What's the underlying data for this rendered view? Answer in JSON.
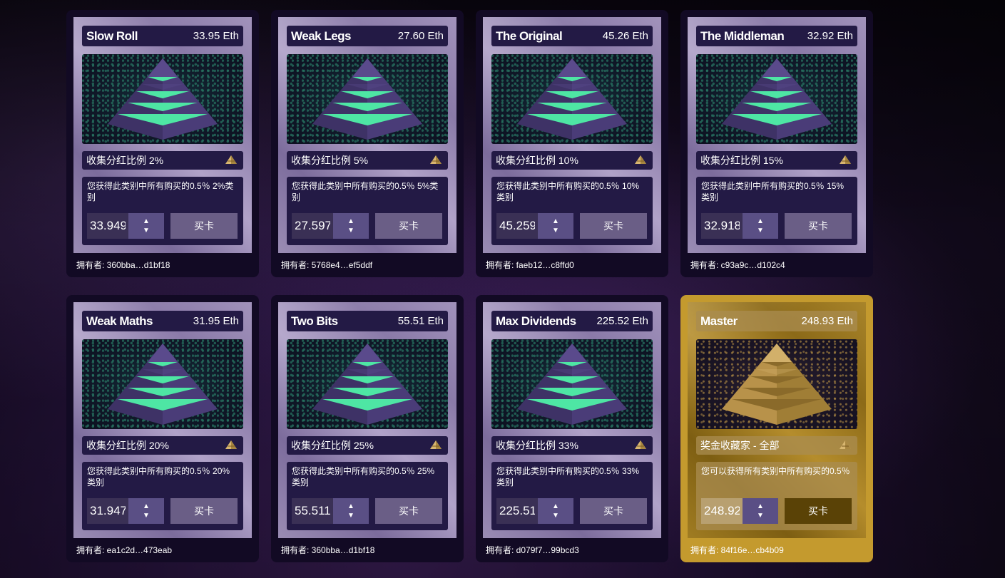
{
  "theme": {
    "card_purple": "#120a24",
    "card_gold": "#c49a2e",
    "stripe_green": "#4ee6a4",
    "pyramid_purple": "#5a4a8c",
    "pyramid_gold": "#d8b670"
  },
  "cards": [
    {
      "name": "Slow Roll",
      "price": "33.95 Eth",
      "rate": "收集分红比例 2%",
      "desc": "您获得此类别中所有购买的0.5％ 2%类别",
      "qty": "33.949",
      "buy": "买卡",
      "owner": "拥有者: 360bba…d1bf18",
      "icon": "pyramid-icon"
    },
    {
      "name": "Weak Legs",
      "price": "27.60 Eth",
      "rate": "收集分红比例 5%",
      "desc": "您获得此类别中所有购买的0.5％ 5%类别",
      "qty": "27.597",
      "buy": "买卡",
      "owner": "拥有者: 5768e4…ef5ddf",
      "icon": "pyramid-icon"
    },
    {
      "name": "The Original",
      "price": "45.26 Eth",
      "rate": "收集分红比例 10%",
      "desc": "您获得此类别中所有购买的0.5％ 10%类别",
      "qty": "45.259",
      "buy": "买卡",
      "owner": "拥有者: faeb12…c8ffd0",
      "icon": "pyramid-icon"
    },
    {
      "name": "The Middleman",
      "price": "32.92 Eth",
      "rate": "收集分红比例 15%",
      "desc": "您获得此类别中所有购买的0.5％ 15%类别",
      "qty": "32.918",
      "buy": "买卡",
      "owner": "拥有者: c93a9c…d102c4",
      "icon": "pyramid-icon"
    },
    {
      "name": "Weak Maths",
      "price": "31.95 Eth",
      "rate": "收集分红比例 20%",
      "desc": "您获得此类别中所有购买的0.5％ 20%类别",
      "qty": "31.947",
      "buy": "买卡",
      "owner": "拥有者: ea1c2d…473eab",
      "icon": "pyramid-icon"
    },
    {
      "name": "Two Bits",
      "price": "55.51 Eth",
      "rate": "收集分红比例 25%",
      "desc": "您获得此类别中所有购买的0.5％ 25%类别",
      "qty": "55.511",
      "buy": "买卡",
      "owner": "拥有者: 360bba…d1bf18",
      "icon": "pyramid-icon"
    },
    {
      "name": "Max Dividends",
      "price": "225.52 Eth",
      "rate": "收集分红比例 33%",
      "desc": "您获得此类别中所有购买的0.5％ 33%类别",
      "qty": "225.51",
      "buy": "买卡",
      "owner": "拥有者: d079f7…99bcd3",
      "icon": "pyramid-icon"
    },
    {
      "name": "Master",
      "price": "248.93 Eth",
      "rate": "奖金收藏家 - 全部",
      "desc": "您可以获得所有类别中所有购买的0.5％",
      "qty": "248.92",
      "buy": "买卡",
      "owner": "拥有者: 84f16e…cb4b09",
      "icon": "pyramid-icon",
      "gold": true
    }
  ]
}
